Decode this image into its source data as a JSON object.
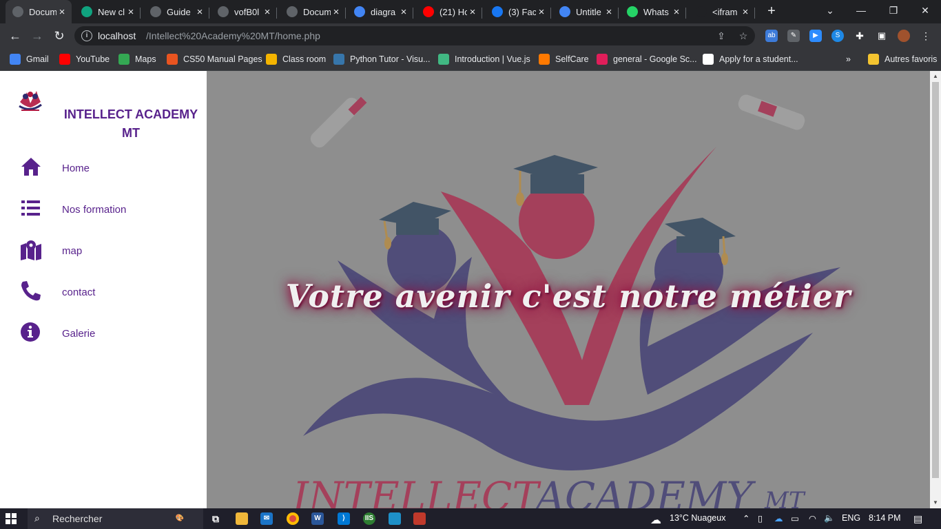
{
  "browser": {
    "tabs": [
      {
        "title": "Docum",
        "icon": "globe-icon",
        "color": "#5f6368",
        "active": true
      },
      {
        "title": "New cl",
        "icon": "chatgpt-icon",
        "color": "#10a37f"
      },
      {
        "title": "Guide",
        "icon": "globe-icon",
        "color": "#5f6368"
      },
      {
        "title": "vofB0l",
        "icon": "globe-icon",
        "color": "#5f6368"
      },
      {
        "title": "Docum",
        "icon": "doc-icon",
        "color": "#5f6368"
      },
      {
        "title": "diagra",
        "icon": "google-icon",
        "color": "#4285f4"
      },
      {
        "title": "(21) Ho",
        "icon": "youtube-icon",
        "color": "#ff0000"
      },
      {
        "title": "(3) Fac",
        "icon": "facebook-icon",
        "color": "#1877f2"
      },
      {
        "title": "Untitle",
        "icon": "docs-icon",
        "color": "#4285f4"
      },
      {
        "title": "Whats",
        "icon": "whatsapp-icon",
        "color": "#25d366"
      },
      {
        "title": "<ifram",
        "icon": "medium-icon",
        "color": "#202124"
      }
    ],
    "url_host": "localhost",
    "url_path": "/Intellect%20Academy%20MT/home.php",
    "bookmarks": [
      {
        "label": "Gmail",
        "icon": "google-icon",
        "color": "#4285f4"
      },
      {
        "label": "YouTube",
        "icon": "youtube-icon",
        "color": "#ff0000"
      },
      {
        "label": "Maps",
        "icon": "maps-icon",
        "color": "#34a853"
      },
      {
        "label": "CS50 Manual Pages",
        "icon": "ubuntu-icon",
        "color": "#e95420"
      },
      {
        "label": "Class room",
        "icon": "classroom-icon",
        "color": "#f4b400"
      },
      {
        "label": "Python Tutor - Visu...",
        "icon": "python-icon",
        "color": "#3776ab"
      },
      {
        "label": "Introduction | Vue.js",
        "icon": "vue-icon",
        "color": "#41b883"
      },
      {
        "label": "SelfCare",
        "icon": "orange-icon",
        "color": "#ff7900"
      },
      {
        "label": "general - Google Sc...",
        "icon": "slack-icon",
        "color": "#e01e5a"
      },
      {
        "label": "Apply for a student...",
        "icon": "github-icon",
        "color": "#ffffff"
      }
    ],
    "bookmarks_more": "»",
    "other_bookmarks": "Autres favoris"
  },
  "site": {
    "brand": "INTELLECT ACADEMY MT",
    "nav": [
      {
        "label": "Home",
        "icon": "home-icon"
      },
      {
        "label": "Nos formation",
        "icon": "list-icon"
      },
      {
        "label": "map",
        "icon": "map-icon"
      },
      {
        "label": "contact",
        "icon": "phone-icon"
      },
      {
        "label": "Galerie",
        "icon": "info-icon"
      }
    ],
    "hero_slogan": "Votre avenir c'est notre métier",
    "hero_logo_text_a": "INTELLECT",
    "hero_logo_text_b": "ACADEMY",
    "hero_logo_text_c": "MT"
  },
  "taskbar": {
    "search_placeholder": "Rechercher",
    "weather": "13°C  Nuageux",
    "lang": "ENG",
    "time": "8:14 PM"
  },
  "colors": {
    "brand_purple": "#58228c",
    "logo_crimson": "#b0163f",
    "logo_navy": "#2e2a6e",
    "hero_bg": "#8e8e8e"
  }
}
